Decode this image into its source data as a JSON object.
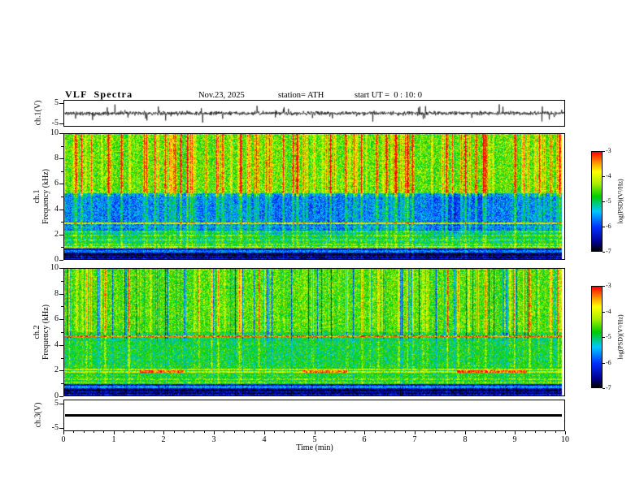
{
  "header": {
    "title": "VLF  Spectra",
    "date": "Nov.23, 2025",
    "station": "station= ATH",
    "start_ut": "start UT =  0 : 10: 0"
  },
  "labels": {
    "ch1_wave": "ch.1(V)",
    "spec1_line1": "ch.1",
    "spec1_line2": "Frequency (kHz)",
    "spec2_line1": "ch.2",
    "spec2_line2": "Frequency (kHz)",
    "ch3_wave": "ch.3(V)"
  },
  "axes": {
    "x_label": "Time (min)",
    "x_ticks": [
      0,
      1,
      2,
      3,
      4,
      5,
      6,
      7,
      8,
      9,
      10
    ],
    "x_range": [
      0,
      10
    ],
    "freq_ticks": [
      0,
      2,
      4,
      6,
      8,
      10
    ],
    "freq_minor_ticks": [
      1,
      3,
      5,
      7,
      9
    ],
    "freq_range": [
      0,
      10
    ],
    "wave_tick_labels": [
      "5",
      "-5"
    ],
    "wave_tick_values": [
      5,
      -5
    ],
    "wave_range": [
      -6.5,
      6.5
    ]
  },
  "colorbar": {
    "label": "log(PSD)(V²/Hz)",
    "ticks": [
      -3,
      -4,
      -5,
      -6,
      -7
    ],
    "range": [
      -7,
      -3
    ]
  },
  "colormap": {
    "stops": [
      [
        0,
        "#000000"
      ],
      [
        0.09,
        "#000090"
      ],
      [
        0.24,
        "#0030ff"
      ],
      [
        0.4,
        "#00c8ff"
      ],
      [
        0.55,
        "#00cc00"
      ],
      [
        0.68,
        "#aaee00"
      ],
      [
        0.8,
        "#ffff00"
      ],
      [
        0.9,
        "#ff8800"
      ],
      [
        1,
        "#ff0000"
      ]
    ]
  },
  "chart_data": [
    {
      "type": "line",
      "name": "ch1_waveform",
      "panel_label": "ch.1(V)",
      "x_range": [
        0,
        10
      ],
      "y_range": [
        -5,
        5
      ],
      "summary": "continuous broadband noise around 0 V (~±1 V) with dense impulsive sferic spikes reaching about ±5 V across the full 10 minutes",
      "seed": 11,
      "spike_prob": 0.028,
      "noise_amp": 1.0
    },
    {
      "type": "heatmap",
      "name": "ch1_spectrogram",
      "panel_label": "ch.1 Frequency (kHz)",
      "x_range": [
        0,
        10
      ],
      "y_range": [
        0,
        10
      ],
      "z_range": [
        -7,
        -3
      ],
      "z_label": "log(PSD)(V²/Hz)",
      "summary": "green background above ~5 kHz crossed by red/yellow vertical sferic streaks; blue low-power band 2.3-5.3 kHz with darker blue patches; layered yellow-green horizontal lines 1-3 kHz; near-black rows below 0.9 kHz",
      "seed": 7,
      "noise": 0.26,
      "dip": true,
      "bands": [
        {
          "f": [
            5.3,
            10
          ],
          "level": 0.56
        },
        {
          "f": [
            2.3,
            5.3
          ],
          "level": 0.33
        },
        {
          "f": [
            0.9,
            2.3
          ],
          "level": 0.48
        },
        {
          "f": [
            0,
            0.9
          ],
          "level": 0.14
        }
      ],
      "lines": [
        {
          "f": 2.9,
          "level": 0.72,
          "wd": 0.06
        },
        {
          "f": 2.6,
          "level": 0.5,
          "wd": 0.05
        },
        {
          "f": 2.2,
          "level": 0.62,
          "wd": 0.05
        },
        {
          "f": 1.9,
          "level": 0.6,
          "wd": 0.05
        },
        {
          "f": 1.55,
          "level": 0.62,
          "wd": 0.05
        },
        {
          "f": 1.2,
          "level": 0.58,
          "wd": 0.05
        },
        {
          "f": 1.0,
          "level": 0.65,
          "wd": 0.05
        },
        {
          "f": 0.65,
          "level": 0.3,
          "wd": 0.07
        },
        {
          "f": 0.4,
          "level": 0.02,
          "wd": 0.1
        },
        {
          "f": 0.15,
          "level": 0.05,
          "wd": 0.08
        }
      ],
      "streaks": {
        "hot_prob": 0.17,
        "hot_min": 0.18,
        "hot_max": 0.55,
        "cold_prob": 0
      }
    },
    {
      "type": "heatmap",
      "name": "ch2_spectrogram",
      "panel_label": "ch.2 Frequency (kHz)",
      "x_range": [
        0,
        10
      ],
      "y_range": [
        0,
        10
      ],
      "z_range": [
        -7,
        -3
      ],
      "z_label": "log(PSD)(V²/Hz)",
      "summary": "mostly green with blue and yellow vertical streaks above ~5 kHz; dark red horizontal line near 4.7 kHz; bright yellow band near 1.8-2.1 kHz with red segments around 1.5-2.4, 4.8-5.7 and 7.9-9.3 min; dark rows below 0.9 kHz",
      "seed": 21,
      "noise": 0.24,
      "dip": false,
      "bands": [
        {
          "f": [
            5.0,
            10
          ],
          "level": 0.55
        },
        {
          "f": [
            2.4,
            5.0
          ],
          "level": 0.5
        },
        {
          "f": [
            0.9,
            2.4
          ],
          "level": 0.52
        },
        {
          "f": [
            0,
            0.9
          ],
          "level": 0.16
        }
      ],
      "lines": [
        {
          "f": 4.7,
          "level": 0.88,
          "wd": 0.05
        },
        {
          "f": 4.4,
          "level": 0.45,
          "wd": 0.05
        },
        {
          "f": 2.1,
          "level": 0.68,
          "wd": 0.05
        },
        {
          "f": 1.9,
          "level": 0.7,
          "wd": 0.06
        },
        {
          "f": 1.6,
          "level": 0.55,
          "wd": 0.05
        },
        {
          "f": 1.3,
          "level": 0.62,
          "wd": 0.05
        },
        {
          "f": 1.05,
          "level": 0.6,
          "wd": 0.05
        },
        {
          "f": 0.7,
          "level": 0.35,
          "wd": 0.07
        },
        {
          "f": 0.45,
          "level": 0.03,
          "wd": 0.1
        },
        {
          "f": 0.2,
          "level": 0.05,
          "wd": 0.07
        }
      ],
      "segments": [
        {
          "f": 1.95,
          "t": [
            1.5,
            2.4
          ],
          "level": 0.93
        },
        {
          "f": 1.95,
          "t": [
            4.75,
            5.65
          ],
          "level": 0.9
        },
        {
          "f": 1.95,
          "t": [
            7.85,
            9.25
          ],
          "level": 0.92
        }
      ],
      "streaks": {
        "hot_prob": 0.1,
        "hot_min": 0.15,
        "hot_max": 0.45,
        "cold_prob": 0.14
      }
    },
    {
      "type": "line",
      "name": "ch3_waveform",
      "panel_label": "ch.3(V)",
      "x_range": [
        0,
        10
      ],
      "y_range": [
        -5,
        5
      ],
      "constant_value": 0,
      "summary": "flat heavy black line at 0 V for the whole record (inactive channel)"
    }
  ]
}
